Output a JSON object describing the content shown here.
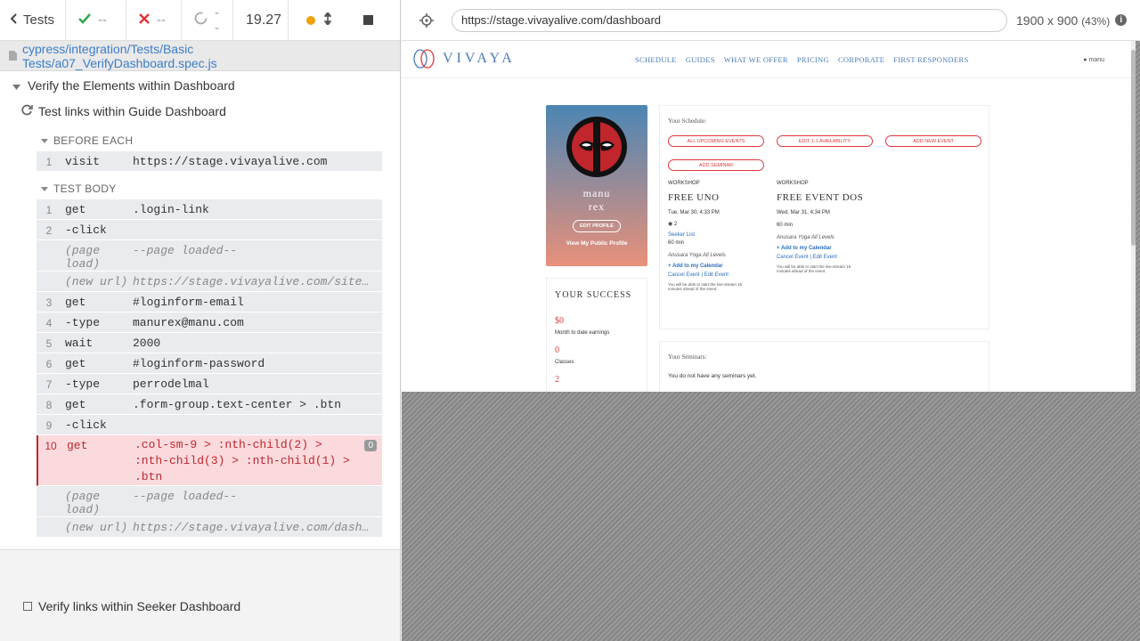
{
  "runner": {
    "tests_label": "Tests",
    "passed": "--",
    "failed": "--",
    "pending": "--",
    "duration": "19.27",
    "spec_path": "cypress/integration/Tests/Basic Tests/a07_VerifyDashboard.spec.js",
    "suite_title": "Verify the Elements within Dashboard",
    "test_title": "Test links within Guide Dashboard",
    "before_each_label": "BEFORE EACH",
    "test_body_label": "TEST BODY",
    "before_each": [
      {
        "num": "1",
        "name": "visit",
        "msg": "https://stage.vivayalive.com"
      }
    ],
    "commands": [
      {
        "num": "1",
        "name": "get",
        "msg": ".login-link"
      },
      {
        "num": "2",
        "name": "-click",
        "msg": ""
      },
      {
        "num": "",
        "name": "(page load)",
        "msg": "--page loaded--"
      },
      {
        "num": "",
        "name": "(new url)",
        "msg": "https://stage.vivayalive.com/site/lo…"
      },
      {
        "num": "3",
        "name": "get",
        "msg": "#loginform-email"
      },
      {
        "num": "4",
        "name": "-type",
        "msg": "manurex@manu.com"
      },
      {
        "num": "5",
        "name": "wait",
        "msg": "2000"
      },
      {
        "num": "6",
        "name": "get",
        "msg": "#loginform-password"
      },
      {
        "num": "7",
        "name": "-type",
        "msg": "perrodelmal"
      },
      {
        "num": "8",
        "name": "get",
        "msg": ".form-group.text-center > .btn"
      },
      {
        "num": "9",
        "name": "-click",
        "msg": ""
      },
      {
        "num": "10",
        "name": "get",
        "msg": ".col-sm-9 > :nth-child(2) > :nth-child(3) > :nth-child(1) > .btn",
        "badge": "0"
      },
      {
        "num": "",
        "name": "(page load)",
        "msg": "--page loaded--"
      },
      {
        "num": "",
        "name": "(new url)",
        "msg": "https://stage.vivayalive.com/dashboa…"
      }
    ],
    "test2_title": "Verify links within Seeker Dashboard"
  },
  "browser": {
    "url": "https://stage.vivayalive.com/dashboard",
    "viewport": "1900 x 900",
    "zoom": "(43%)"
  },
  "app": {
    "logo": "VIVAYA",
    "menu": [
      "SCHEDULE",
      "GUIDES",
      "WHAT WE OFFER",
      "PRICING",
      "CORPORATE",
      "FIRST RESPONDERS"
    ],
    "user": "manu",
    "profile_name_1": "manu",
    "profile_name_2": "rex",
    "edit_profile": "EDIT PROFILE",
    "public_profile": "View My Public Profile",
    "success_title": "YOUR SUCCESS",
    "earnings_value": "$0",
    "earnings_label": "Month to date earnings",
    "classes_value": "0",
    "classes_label": "Classes",
    "third_value": "2",
    "schedule_title": "Your Schedule:",
    "btn_all": "ALL UPCOMING EVENTS",
    "btn_edit": "EDIT 1-1 AVAILABILITY",
    "btn_new": "ADD NEW EVENT",
    "btn_seminar": "ADD SEMINAR",
    "ev1": {
      "type": "WORKSHOP",
      "name": "FREE UNO",
      "date": "Tue, Mar 30, 4:33 PM",
      "attendees": "2",
      "seeker": "Seeker List",
      "dur": "60 min",
      "style": "Anusara Yoga All Levels",
      "add": "+ Add to my Calendar",
      "cancel": "Cancel Event | Edit Event",
      "note": "You will be able to start the live-stream 15 minutes ahead of the event."
    },
    "ev2": {
      "type": "WORKSHOP",
      "name": "FREE EVENT DOS",
      "date": "Wed, Mar 31, 4:34 PM",
      "dur": "60 min",
      "style": "Anusara Yoga All Levels",
      "add": "+ Add to my Calendar",
      "cancel": "Cancel Event | Edit Event",
      "note": "You will be able to start the live-stream 15 minutes ahead of the event."
    },
    "seminars_title": "Your Seminars:",
    "seminars_empty": "You do not have any seminars yet."
  }
}
